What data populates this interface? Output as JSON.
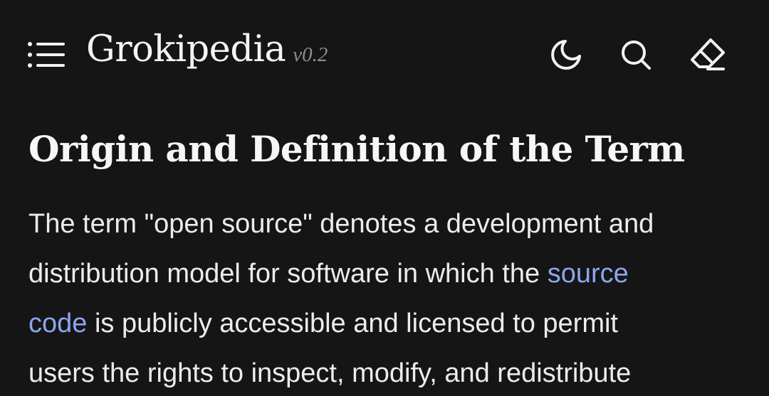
{
  "header": {
    "brand": "Grokipedia",
    "version": "v0.2",
    "icons": {
      "menu": "menu-list-icon",
      "theme": "moon-icon",
      "search": "search-icon",
      "edit": "eraser-icon"
    }
  },
  "article": {
    "section_title": "Origin and Definition of the Term",
    "paragraph": {
      "line1": "The term \"open source\" denotes a development and",
      "line2_before_link": "distribution model for software in which the ",
      "link_part1": "source",
      "link_part2": "code",
      "line3_after_link": " is publicly accessible and licensed to permit",
      "line4": "users the rights to inspect, modify, and redistribute"
    }
  },
  "colors": {
    "background": "#151515",
    "text": "#ececec",
    "link": "#8ba6ee",
    "muted": "#8e8e8e"
  }
}
